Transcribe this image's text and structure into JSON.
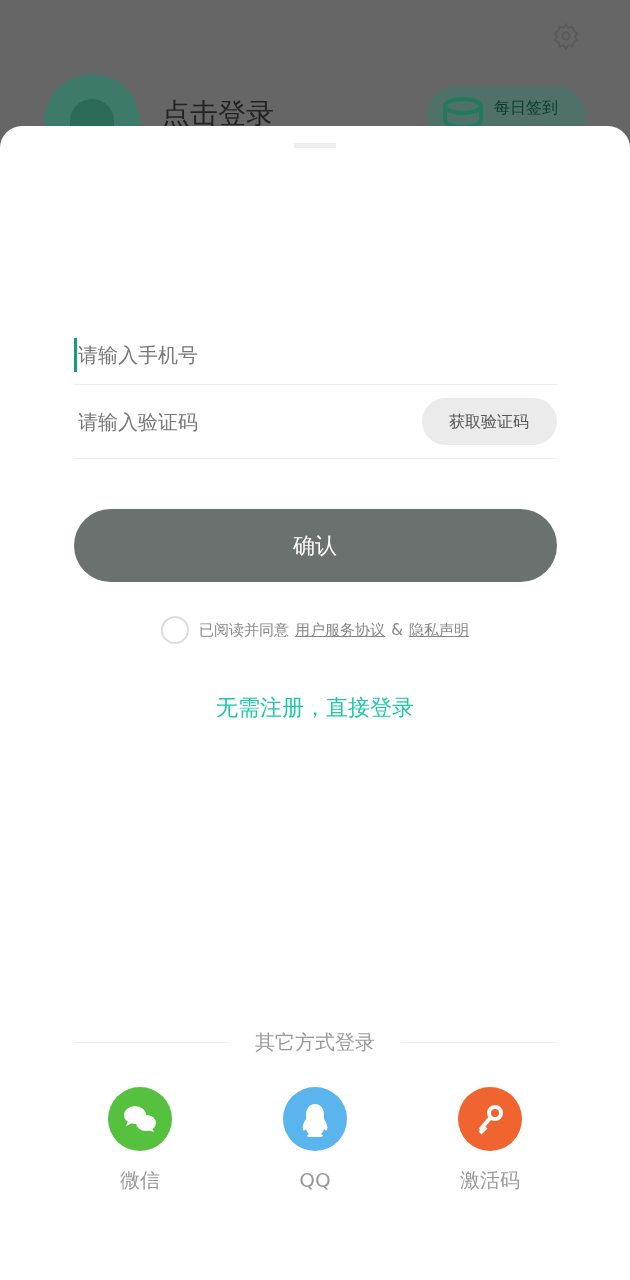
{
  "profile": {
    "name": "点击登录",
    "checkin": "每日签到"
  },
  "form": {
    "phone": {
      "placeholder": "请输入手机号"
    },
    "code": {
      "placeholder": "请输入验证码"
    },
    "get_code": "获取验证码",
    "confirm": "确认"
  },
  "agreement": {
    "checked": false,
    "prefix": "已阅读并同意",
    "terms": "用户服务协议",
    "joiner": "&",
    "privacy": "隐私声明"
  },
  "guest_login": "无需注册，直接登录",
  "other_login": {
    "title": "其它方式登录",
    "options": [
      {
        "kind": "wechat",
        "label": "微信",
        "color": "#55c13e"
      },
      {
        "kind": "qq",
        "label": "QQ",
        "color": "#5ab4ee"
      },
      {
        "kind": "key",
        "label": "激活码",
        "color": "#f0652f"
      }
    ]
  }
}
